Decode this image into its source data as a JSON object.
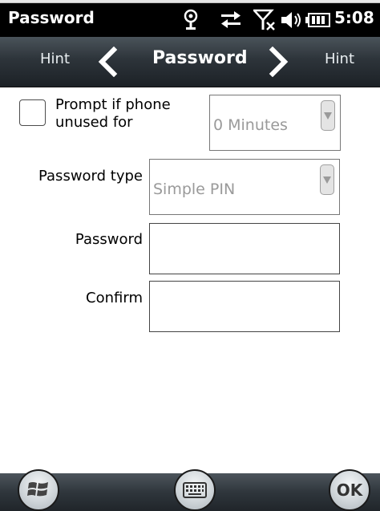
{
  "status_bar": {
    "title": "Password",
    "time": "5:08",
    "icons": [
      "gps-icon",
      "data-transfer-icon",
      "no-signal-icon",
      "volume-icon",
      "battery-icon"
    ]
  },
  "nav_bar": {
    "left_hint": "Hint",
    "title": "Password",
    "right_hint": "Hint"
  },
  "form": {
    "prompt_checkbox": {
      "label": "Prompt if phone\nunused for",
      "checked": false
    },
    "timeout_dropdown": {
      "value": "0 Minutes"
    },
    "password_type": {
      "label": "Password type",
      "value": "Simple PIN"
    },
    "password_field": {
      "label": "Password",
      "value": ""
    },
    "confirm_field": {
      "label": "Confirm",
      "value": ""
    }
  },
  "bottom_bar": {
    "ok_label": "OK",
    "buttons": [
      "windows-start-icon",
      "keyboard-icon",
      "ok-button"
    ]
  },
  "colors": {
    "status_bar_bg": "#000000",
    "nav_bar_bg": "#2d343a",
    "disabled_text": "#9a9a9a"
  }
}
